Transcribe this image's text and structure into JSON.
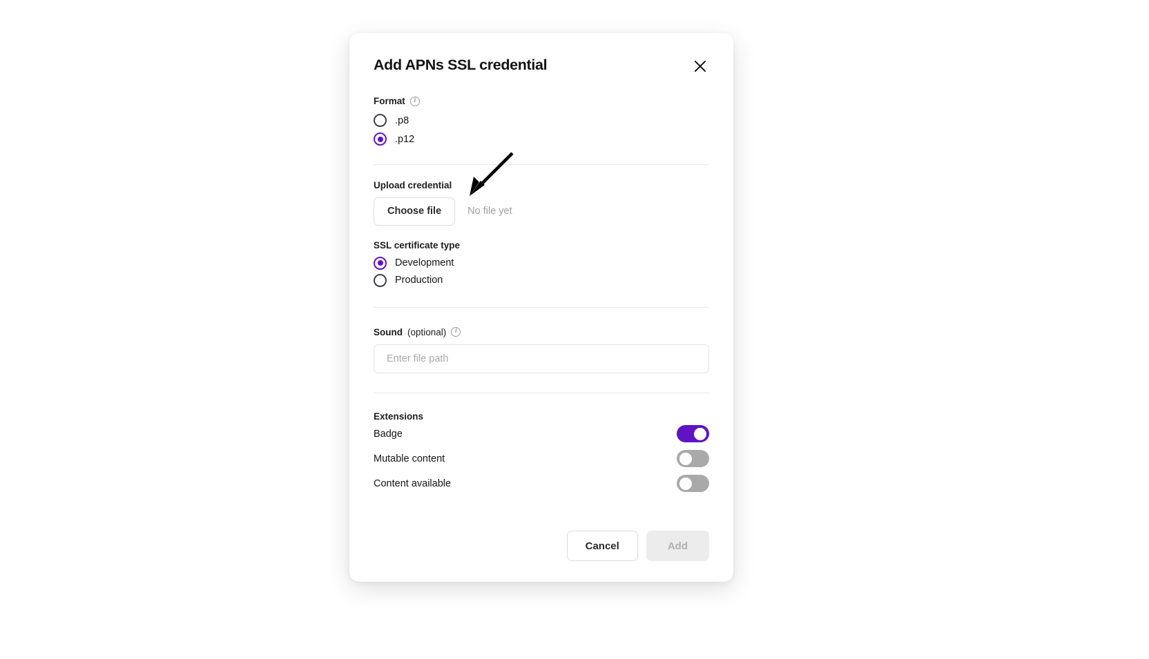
{
  "dialog": {
    "title": "Add APNs SSL credential",
    "close_icon": "close-icon"
  },
  "format": {
    "label": "Format",
    "info_icon": "info-icon",
    "options": [
      {
        "label": ".p8",
        "selected": false
      },
      {
        "label": ".p12",
        "selected": true
      }
    ]
  },
  "upload": {
    "label": "Upload credential",
    "button_label": "Choose file",
    "file_status": "No file yet"
  },
  "certificate": {
    "label": "SSL certificate type",
    "options": [
      {
        "label": "Development",
        "selected": true
      },
      {
        "label": "Production",
        "selected": false
      }
    ]
  },
  "sound": {
    "label": "Sound",
    "optional_suffix": "(optional)",
    "info_icon": "info-icon",
    "placeholder": "Enter file path",
    "value": ""
  },
  "extensions": {
    "title": "Extensions",
    "items": [
      {
        "label": "Badge",
        "on": true
      },
      {
        "label": "Mutable content",
        "on": false
      },
      {
        "label": "Content available",
        "on": false
      }
    ]
  },
  "footer": {
    "cancel_label": "Cancel",
    "add_label": "Add"
  },
  "colors": {
    "accent_purple": "#6013c4",
    "toggle_off_gray": "#a9a9a9",
    "disabled_button_bg": "#ececec",
    "disabled_button_text": "#b0b0b0",
    "muted_text": "#9e9e9e",
    "border": "#dcdcdc"
  },
  "annotation": {
    "arrow": "arrow-pointing-to-choose-file-button"
  }
}
